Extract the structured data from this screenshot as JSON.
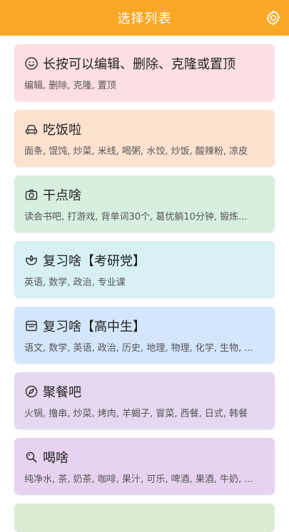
{
  "header": {
    "title": "选择列表",
    "settings_icon": "gear-icon"
  },
  "colors": {
    "header": "#f9a825",
    "pink": "#fcdfe2",
    "peach": "#fde2d0",
    "green": "#d8efe0",
    "cyan": "#d6f0f4",
    "blue": "#d4e6fb",
    "purple": "#e6d8f1",
    "lavender": "#e7d3f0"
  },
  "cards": [
    {
      "icon": "smile-icon",
      "title": "长按可以编辑、删除、克隆或置顶",
      "subtitle": "编辑, 删除, 克隆, 置顶"
    },
    {
      "icon": "car-icon",
      "title": "吃饭啦",
      "subtitle": "面条, 馄饨, 炒菜, 米线, 喝粥, 水饺, 炒饭, 酸辣粉, 凉皮"
    },
    {
      "icon": "camera-icon",
      "title": "干点啥",
      "subtitle": "读会书吧, 打游戏, 背单词30个, 葛优躺10分钟, 锻炼..."
    },
    {
      "icon": "flower-icon",
      "title": "复习啥【考研党】",
      "subtitle": "英语, 数学, 政治, 专业课"
    },
    {
      "icon": "shop-icon",
      "title": "复习啥【高中生】",
      "subtitle": "语文, 数学, 英语, 政治, 历史, 地理, 物理, 化学, 生物, ..."
    },
    {
      "icon": "compass-icon",
      "title": "聚餐吧",
      "subtitle": "火锅, 撸串, 炒菜, 烤肉, 羊蝎子, 冒菜, 西餐, 日式, 韩餐"
    },
    {
      "icon": "search-icon",
      "title": "喝啥",
      "subtitle": "纯净水, 茶, 奶茶, 咖啡, 果汁, 可乐, 啤酒, 果酒, 牛奶, ..."
    }
  ]
}
